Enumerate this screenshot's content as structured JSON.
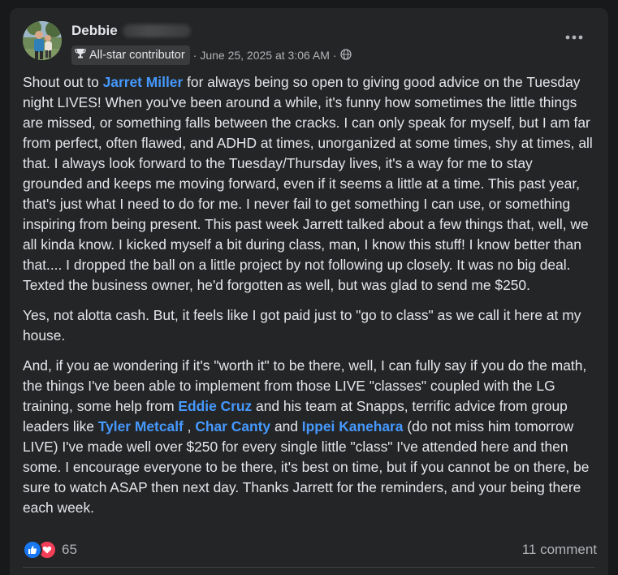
{
  "post": {
    "author_first_name": "Debbie",
    "badge_label": "All-star contributor",
    "timestamp": "June 25, 2025 at 3:06 AM",
    "separator": "·",
    "paragraph1": {
      "t1": "Shout out to ",
      "mention1": "Jarret Miller",
      "t2": " for always being so open to giving good advice on the Tuesday night LIVES! When you've been around a while, it's funny how sometimes the little things are missed, or something falls between the cracks. I can only speak for myself, but I am far from perfect, often flawed, and ADHD at times, unorganized at some times, shy at times, all that. I always look forward to the Tuesday/Thursday lives, it's a way for me to stay grounded and keeps me moving forward, even if it seems a little at a time. This past year, that's just what I need to do for me. I never fail to get something I can use, or something inspiring from being present. This past week Jarrett talked about a few things that, well, we all kinda know. I kicked myself a bit during class, man, I know this stuff! I know better than that.... I dropped the ball on a little project by not following up closely. It was no big deal. Texted the business owner, he'd forgotten as well,  but was glad to send me $250."
    },
    "paragraph2": "Yes, not alotta cash. But, it feels like I got paid just to \"go to class\" as we call it here at my house.",
    "paragraph3": {
      "t1": "And, if you ae wondering if it's \"worth it\" to be there, well, I can fully say if you do the math, the things I've been able to implement from those LIVE \"classes\" coupled with the LG training, some help from ",
      "mention1": "Eddie Cruz",
      "t2": " and his team at Snapps, terrific advice from group leaders like ",
      "mention2": "Tyler Metcalf",
      "t3": " , ",
      "mention3": "Char Canty",
      "t4": "  and ",
      "mention4": "Ippei Kanehara",
      "t5": " (do not miss him tomorrow LIVE) I've made well over $250 for every single little \"class\" I've attended here and then some. I encourage everyone to be there, it's best on time, but if you cannot be on there, be sure to watch ASAP then next day. Thanks Jarrett for the reminders, and your being there each week."
    },
    "reaction_count": "65",
    "comment_count": "11 comment"
  },
  "icons": {
    "badge": "trophy-icon",
    "audience": "globe-icon",
    "menu": "more-options-icon",
    "reaction1": "like-icon",
    "reaction2": "love-icon"
  },
  "colors": {
    "background": "#18191a",
    "card": "#242526",
    "text": "#e4e6eb",
    "secondary_text": "#b0b3b8",
    "mention": "#4599ff",
    "like": "#1877f2",
    "love": "#f33e58"
  }
}
